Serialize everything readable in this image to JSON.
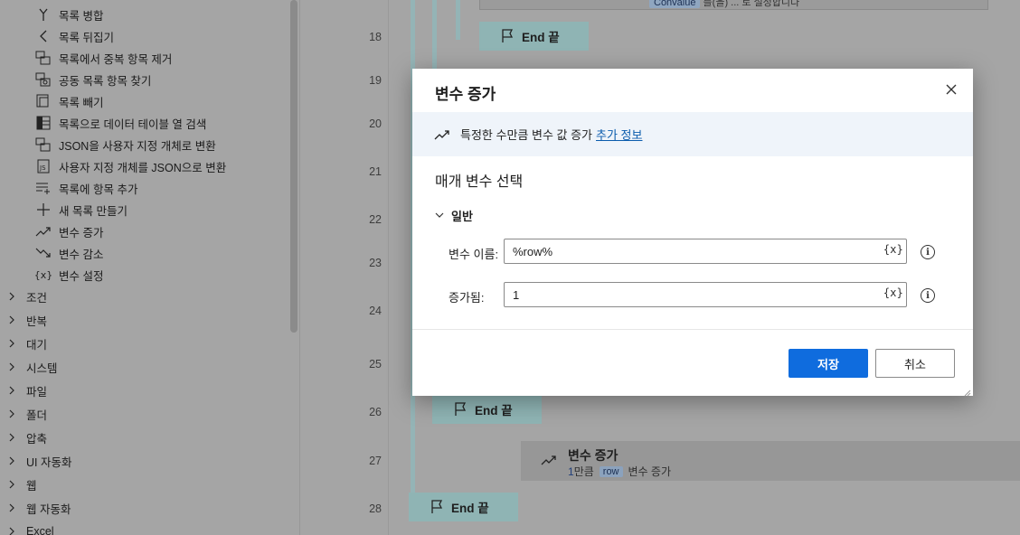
{
  "actions_panel": {
    "items": [
      {
        "label": "목록 병합",
        "icon": "merge-icon"
      },
      {
        "label": "목록 뒤집기",
        "icon": "reverse-icon"
      },
      {
        "label": "목록에서 중복 항목 제거",
        "icon": "remove-duplicates-icon"
      },
      {
        "label": "공동 목록 항목 찾기",
        "icon": "find-common-icon"
      },
      {
        "label": "목록 빼기",
        "icon": "subtract-list-icon"
      },
      {
        "label": "목록으로 데이터 테이블 열 검색",
        "icon": "table-column-icon"
      },
      {
        "label": "JSON을 사용자 지정 개체로 변환",
        "icon": "json-convert-icon"
      },
      {
        "label": "사용자 지정 개체를 JSON으로 변환",
        "icon": "json-file-icon"
      },
      {
        "label": "목록에 항목 추가",
        "icon": "add-list-item-icon"
      },
      {
        "label": "새 목록 만들기",
        "icon": "plus-icon"
      },
      {
        "label": "변수 증가",
        "icon": "trend-up-icon"
      },
      {
        "label": "변수 감소",
        "icon": "trend-down-icon"
      },
      {
        "label": "변수 설정",
        "icon": "variable-braces-icon"
      }
    ],
    "categories": [
      "조건",
      "반복",
      "대기",
      "시스템",
      "파일",
      "폴더",
      "압축",
      "UI 자동화",
      "웹",
      "웹 자동화",
      "Excel"
    ]
  },
  "flow": {
    "line_numbers": [
      "18",
      "19",
      "20",
      "21",
      "22",
      "23",
      "24",
      "25",
      "26",
      "27",
      "28"
    ],
    "top_card_text_tag": "Convalue",
    "top_card_text_rest": " 를(을) ... 로 설정합니다",
    "end_blocks": [
      {
        "label": "End 끝"
      },
      {
        "label": "End 끝"
      },
      {
        "label": "End 끝"
      }
    ],
    "increment_card": {
      "title": "변수 증가",
      "amount": "1",
      "amount_unit": "만큼",
      "variable": "row",
      "suffix": "변수 증가",
      "more_icon": "⋮"
    }
  },
  "dialog": {
    "title": "변수 증가",
    "info_text": "특정한 수만큼 변수 값 증가",
    "info_link": "추가 정보",
    "section_title": "매개 변수 선택",
    "group_label": "일반",
    "fields": [
      {
        "label": "변수 이름:",
        "value": "%row%",
        "var_button": "{x}",
        "info": "i"
      },
      {
        "label": "증가됨:",
        "value": "1",
        "var_button": "{x}",
        "info": "i"
      }
    ],
    "save_label": "저장",
    "cancel_label": "취소"
  },
  "colors": {
    "primary_button": "#0f6cde",
    "link": "#0b5cad",
    "info_bar": "#eff4fa",
    "overlay": "#a5a5a5"
  }
}
